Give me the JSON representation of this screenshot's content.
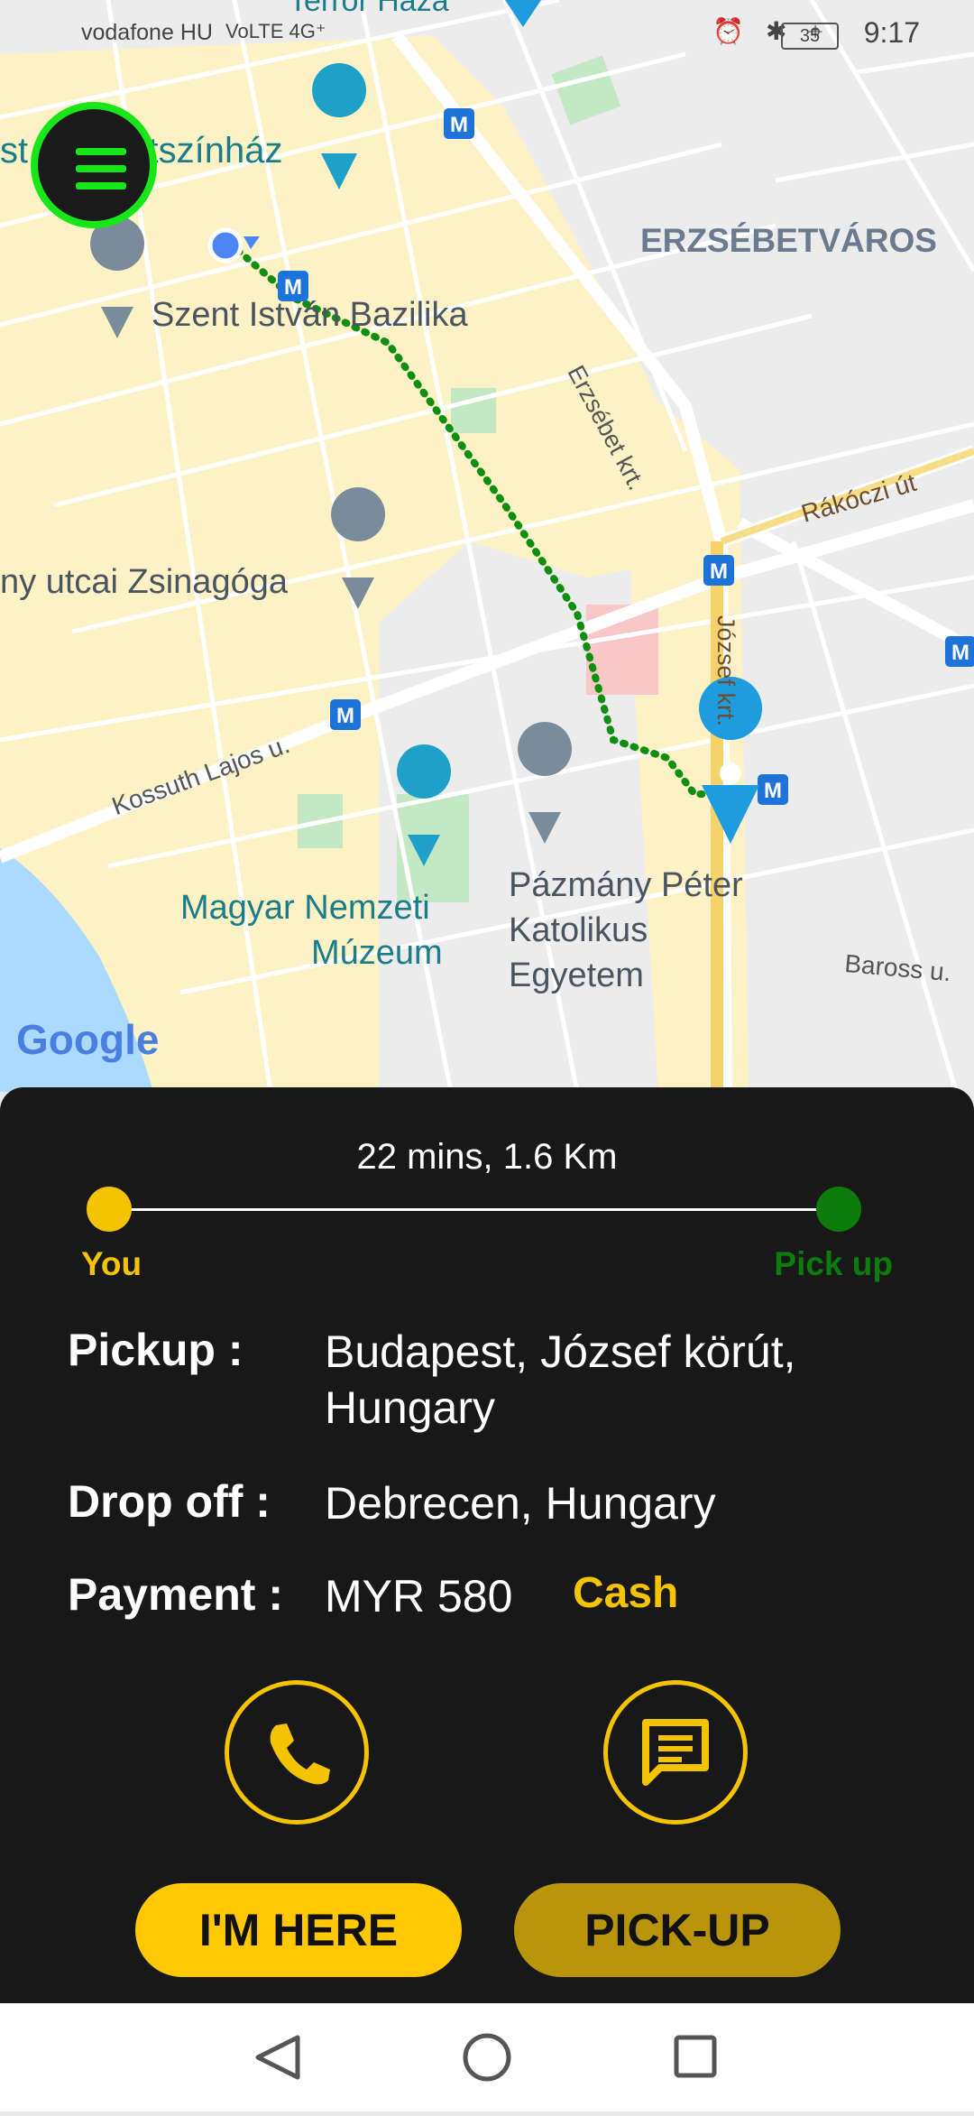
{
  "status_bar": {
    "carrier": "vodafone HU",
    "network_badges": "VoLTE 4G⁺",
    "battery": "35",
    "time": "9:17"
  },
  "map": {
    "labels": {
      "terror": "Terror Háza",
      "operett": "st Operettszínház",
      "erzsebetvaros": "ERZSÉBETVÁROS",
      "bazilika": "Szent István Bazilika",
      "erzsebet_krt": "Erzsébet krt.",
      "rakoczi": "Rákóczi út",
      "zsinagoga": "ny utcai Zsinagóga",
      "jozsef_krt": "József krt.",
      "kossuth": "Kossuth Lajos u.",
      "pazmany1": "Pázmány Péter",
      "pazmany2": "Katolikus",
      "pazmany3": "Egyetem",
      "muzeum1": "Magyar Nemzeti",
      "muzeum2": "Múzeum",
      "baross": "Baross u.",
      "google": "Google"
    },
    "metro": "M"
  },
  "trip": {
    "eta": "22 mins, 1.6 Km",
    "you_label": "You",
    "pickup_label": "Pick up"
  },
  "details": {
    "pickup_key": "Pickup :",
    "pickup_value": "Budapest, József körút, Hungary",
    "dropoff_key": "Drop off :",
    "dropoff_value": "Debrecen, Hungary",
    "payment_key": "Payment :",
    "payment_value": "MYR 580",
    "payment_method": "Cash"
  },
  "actions": {
    "im_here": "I'M HERE",
    "pick_up": "PICK-UP"
  },
  "colors": {
    "accent": "#f5c400",
    "route": "#0f9d0f",
    "panel": "#181818",
    "pin": "#1e9ce0"
  }
}
